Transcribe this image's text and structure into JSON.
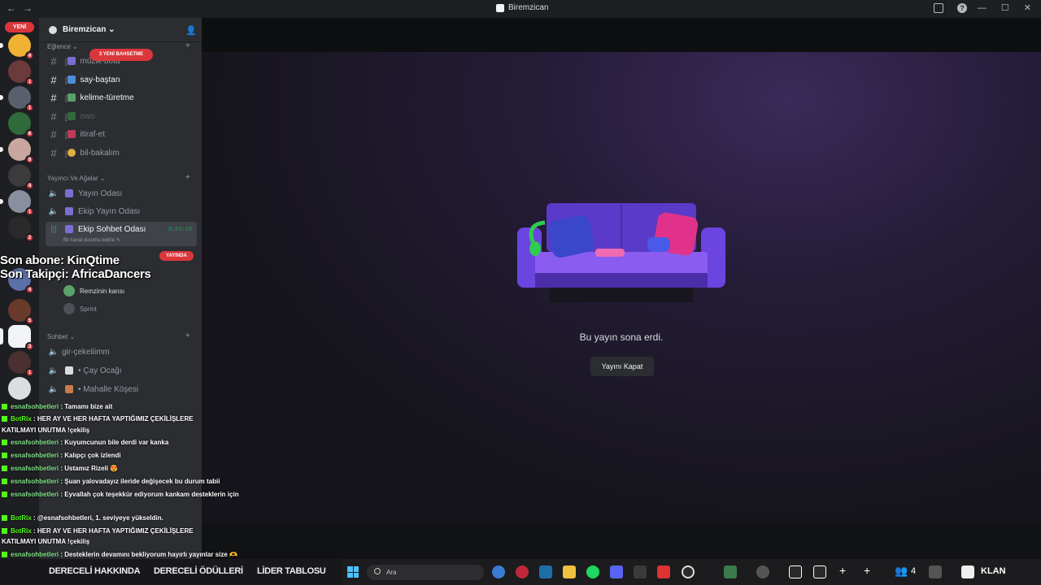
{
  "window": {
    "title": "Biremzican"
  },
  "guilds": {
    "new_label": "YENİ",
    "items": [
      {
        "badge": "4"
      },
      {
        "badge": "1"
      },
      {
        "badge": "1"
      },
      {
        "badge": "6"
      },
      {
        "badge": "8"
      },
      {
        "badge": "4"
      },
      {
        "badge": "1"
      },
      {
        "badge": "2"
      },
      {
        "badge": "4"
      },
      {
        "badge": "5"
      },
      {
        "badge": "3"
      },
      {
        "badge": "1"
      }
    ]
  },
  "server": {
    "name": "Biremzican",
    "mention_pill": "3 YENİ BAHSETME",
    "categories": {
      "eglence": "Eğlence",
      "yayinci": "Yayıncı Ve Ağalar",
      "sohbet": "Sohbet"
    },
    "channels": {
      "muzik": "müzik-bota",
      "say": "say-baştan",
      "kelime": "kelime-türetme",
      "owo": "owo",
      "itiraf": "itiraf-et",
      "bil": "bil-bakalım",
      "yayin_odasi": "Yayın Odası",
      "ekip_yayin": "Ekip Yayın Odası",
      "ekip_sohbet": "Ekip Sohbet Odası",
      "ekip_sohbet_timer": "3:23:23",
      "ekip_sohbet_status": "Bir kanal durumu belirle",
      "gir": "gir-çekeliimm",
      "cay": "• Çay Ocağı",
      "mahalle": "• Mahalle Köşesi"
    },
    "live_pill": "YAYINDA",
    "voice_users": [
      "Remzinin karısı",
      "Sprint"
    ]
  },
  "stage": {
    "end_text": "Bu yayın sona erdi.",
    "close_button": "Yayını Kapat"
  },
  "overlay": {
    "line1": "Son abone: KinQtime",
    "line2": "Son Takipçi: AfricaDancers"
  },
  "chat": [
    {
      "user": "esnafsohbetleri",
      "text": " : Tamamı bize ait"
    },
    {
      "user": "BotRix",
      "text": " : HER AY VE HER HAFTA YAPTIĞIMIZ ÇEKİLİŞLERE"
    },
    {
      "user": "",
      "text": "KATILMAYI UNUTMA !çekiliş"
    },
    {
      "user": "esnafsohbetleri",
      "text": " : Kuyumcunun bile derdi var kanka"
    },
    {
      "user": "esnafsohbetleri",
      "text": " : Kalıpçı çok izlendi"
    },
    {
      "user": "esnafsohbetleri",
      "text": " : Ustamız Rizeli 😍"
    },
    {
      "user": "esnafsohbetleri",
      "text": " : Şuan yalovadayız ileride değişecek bu durum tabii"
    },
    {
      "user": "esnafsohbetleri",
      "text": " : Eyvallah çok teşekkür ediyorum kankam desteklerin için"
    },
    {
      "user": "BotRix",
      "text": " : @esnafsohbetleri, 1. seviyeye yükseldin."
    },
    {
      "user": "BotRix",
      "text": " : HER AY VE HER HAFTA YAPTIĞIMIZ ÇEKİLİŞLERE"
    },
    {
      "user": "",
      "text": "KATILMAYI UNUTMA !çekiliş"
    },
    {
      "user": "esnafsohbetleri",
      "text": " : Desteklerin devamını bekliyorum hayırlı yayınlar size 🫶"
    },
    {
      "user": "esnafsohbetleri",
      "text": " : 💚"
    }
  ],
  "kick_menu": [
    "DERECELİ HAKKINDA",
    "DERECELİ ÖDÜLLERİ",
    "LİDER TABLOSU"
  ],
  "taskbar": {
    "search_placeholder": "Ara",
    "viewer_count": "4",
    "clan_label": "KLAN"
  },
  "colors": {
    "accent": "#5865f2",
    "live": "#da373c",
    "kick_green": "#53fc18"
  }
}
